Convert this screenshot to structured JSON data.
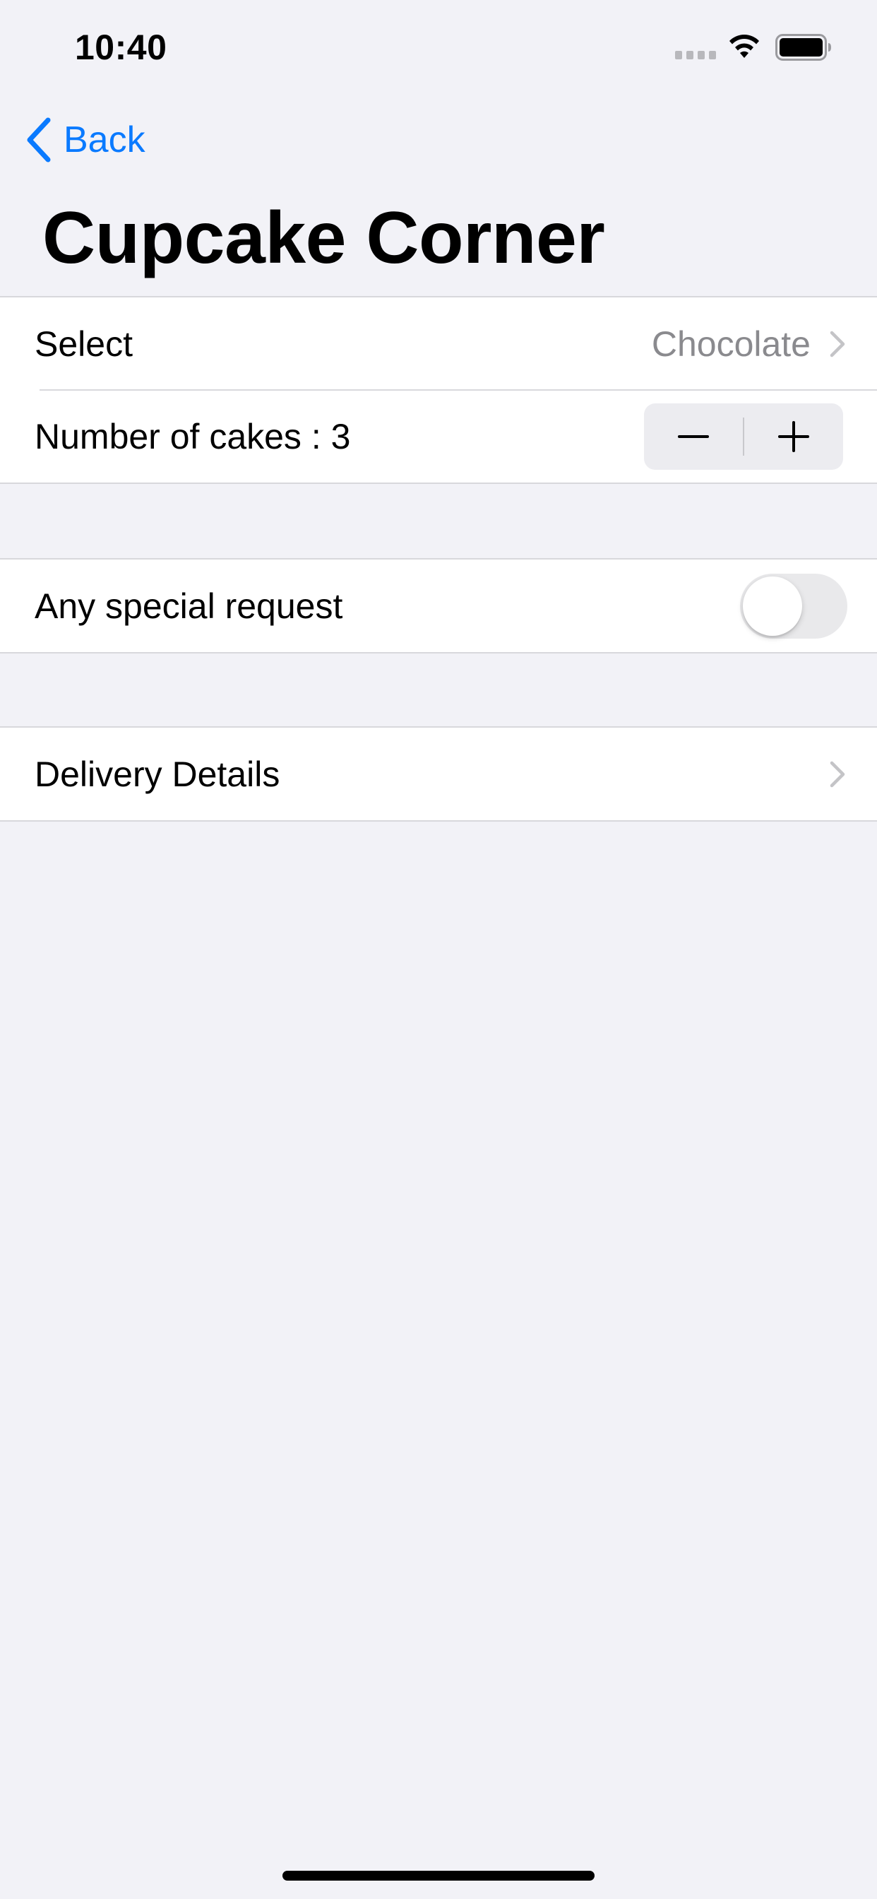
{
  "status_bar": {
    "time": "10:40"
  },
  "nav": {
    "back_label": "Back",
    "title": "Cupcake Corner"
  },
  "order_section": {
    "select_label": "Select",
    "select_value": "Chocolate",
    "quantity_label": "Number of cakes : 3"
  },
  "special_section": {
    "label": "Any special request",
    "toggle_on": false
  },
  "delivery_section": {
    "label": "Delivery Details"
  },
  "colors": {
    "accent": "#0a7aff",
    "background": "#f2f2f7",
    "secondary_text": "#8a8a8e"
  },
  "icons": [
    "chevron-left-icon",
    "chevron-right-icon",
    "minus-icon",
    "plus-icon",
    "wifi-icon",
    "battery-icon",
    "signal-icon"
  ]
}
